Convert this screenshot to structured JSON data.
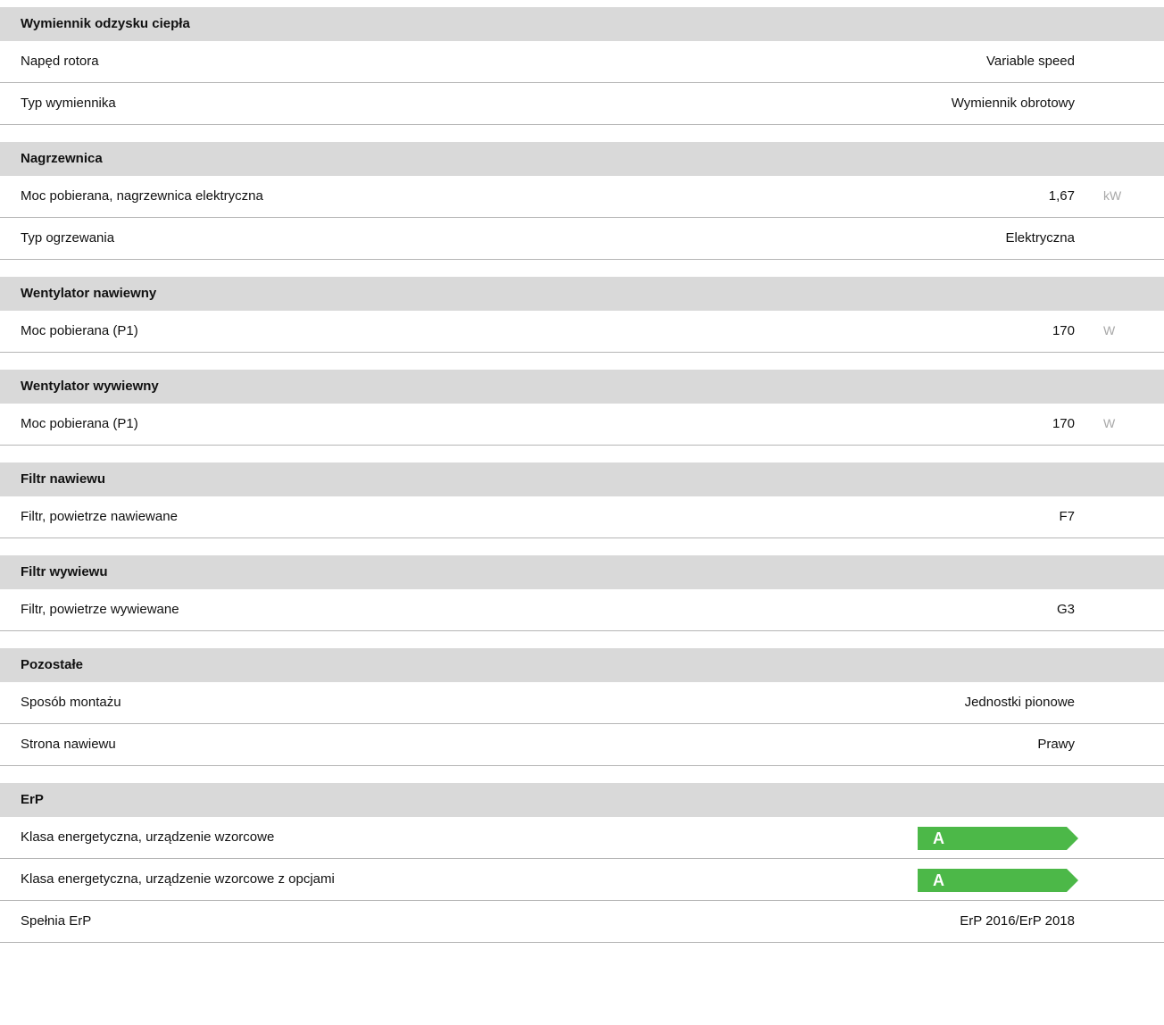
{
  "sections": [
    {
      "title": "Wymiennik odzysku ciepła",
      "rows": [
        {
          "label": "Napęd rotora",
          "value": "Variable speed"
        },
        {
          "label": "Typ wymiennika",
          "value": "Wymiennik obrotowy"
        }
      ]
    },
    {
      "title": "Nagrzewnica",
      "rows": [
        {
          "label": "Moc pobierana, nagrzewnica elektryczna",
          "value": "1,67",
          "unit": "kW"
        },
        {
          "label": "Typ ogrzewania",
          "value": "Elektryczna"
        }
      ]
    },
    {
      "title": "Wentylator nawiewny",
      "rows": [
        {
          "label": "Moc pobierana (P1)",
          "value": "170",
          "unit": "W"
        }
      ]
    },
    {
      "title": "Wentylator wywiewny",
      "rows": [
        {
          "label": "Moc pobierana (P1)",
          "value": "170",
          "unit": "W"
        }
      ]
    },
    {
      "title": "Filtr nawiewu",
      "rows": [
        {
          "label": "Filtr, powietrze nawiewane",
          "value": "F7"
        }
      ]
    },
    {
      "title": "Filtr wywiewu",
      "rows": [
        {
          "label": "Filtr, powietrze wywiewane",
          "value": "G3"
        }
      ]
    },
    {
      "title": "Pozostałe",
      "rows": [
        {
          "label": "Sposób montażu",
          "value": "Jednostki pionowe"
        },
        {
          "label": "Strona nawiewu",
          "value": "Prawy"
        }
      ]
    },
    {
      "title": "ErP",
      "rows": [
        {
          "label": "Klasa energetyczna, urządzenie wzorcowe",
          "badge": "A"
        },
        {
          "label": "Klasa energetyczna, urządzenie wzorcowe z opcjami",
          "badge": "A"
        },
        {
          "label": "Spełnia ErP",
          "value": "ErP 2016/ErP 2018"
        }
      ]
    }
  ],
  "colors": {
    "header_bg": "#d9d9d9",
    "row_border": "#b5b5b5",
    "unit_text": "#a8a8a8",
    "energy_badge_green": "#4cb848"
  }
}
